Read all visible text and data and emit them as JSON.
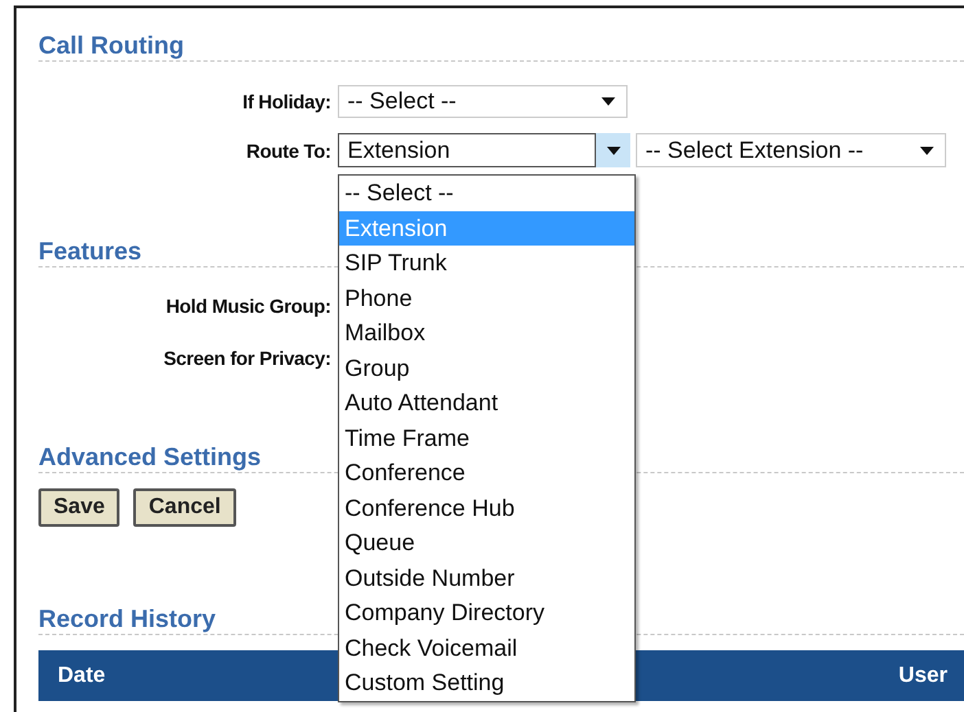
{
  "call_routing": {
    "title": "Call Routing",
    "fields": [
      {
        "label": "If Holiday:",
        "value": "-- Select --",
        "kind": "select"
      },
      {
        "label": "Route To:",
        "value": "Extension",
        "kind": "combo",
        "extension": "-- Select Extension --"
      }
    ],
    "dropdown": {
      "options": [
        {
          "label": "-- Select --",
          "selected": false
        },
        {
          "label": "Extension",
          "selected": true
        },
        {
          "label": "SIP Trunk",
          "selected": false
        },
        {
          "label": "Phone",
          "selected": false
        },
        {
          "label": "Mailbox",
          "selected": false
        },
        {
          "label": "Group",
          "selected": false
        },
        {
          "label": "Auto Attendant",
          "selected": false
        },
        {
          "label": "Time Frame",
          "selected": false
        },
        {
          "label": "Conference",
          "selected": false
        },
        {
          "label": "Conference Hub",
          "selected": false
        },
        {
          "label": "Queue",
          "selected": false
        },
        {
          "label": "Outside Number",
          "selected": false
        },
        {
          "label": "Company Directory",
          "selected": false
        },
        {
          "label": "Check Voicemail",
          "selected": false
        },
        {
          "label": "Custom Setting",
          "selected": false
        }
      ]
    }
  },
  "features": {
    "title": "Features",
    "fields": [
      {
        "label": "Hold Music Group:"
      },
      {
        "label": "Screen for Privacy:"
      }
    ]
  },
  "advanced_settings": {
    "title": "Advanced Settings"
  },
  "buttons": [
    "Save",
    "Cancel"
  ],
  "record_history": {
    "title": "Record History",
    "columns": [
      "Date",
      "User"
    ]
  }
}
